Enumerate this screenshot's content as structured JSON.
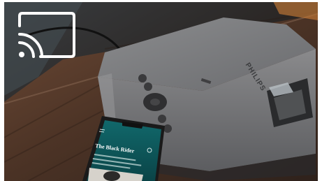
{
  "image": {
    "subject": "Philips projector on a wooden table with a smartphone casting to it",
    "overlay_icon": "cast-icon",
    "colors": {
      "background_dark": "#2b2623",
      "table_wood": "#5a3f2e",
      "projector_body": "#7d7d7f",
      "phone_teal": "#0f5f63",
      "icon_white": "#ffffff"
    }
  },
  "projector": {
    "brand": "PHILIPS"
  },
  "phone": {
    "app_title": "The Black Rider"
  }
}
